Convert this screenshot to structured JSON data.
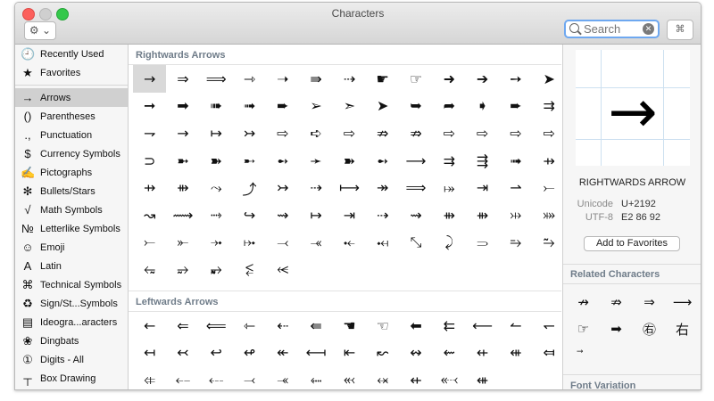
{
  "window": {
    "title": "Characters"
  },
  "toolbar": {
    "gear_label": "⚙ ⌄",
    "search_placeholder": "Search",
    "grid_icon": "⌘"
  },
  "sidebar": {
    "top": [
      {
        "icon": "🕘",
        "label": "Recently Used"
      },
      {
        "icon": "★",
        "label": "Favorites"
      }
    ],
    "items": [
      {
        "icon": "→",
        "label": "Arrows",
        "selected": true
      },
      {
        "icon": "()",
        "label": "Parentheses"
      },
      {
        "icon": ".,",
        "label": "Punctuation"
      },
      {
        "icon": "$",
        "label": "Currency Symbols"
      },
      {
        "icon": "✍",
        "label": "Pictographs"
      },
      {
        "icon": "✻",
        "label": "Bullets/Stars"
      },
      {
        "icon": "√",
        "label": "Math Symbols"
      },
      {
        "icon": "№",
        "label": "Letterlike Symbols"
      },
      {
        "icon": "☺",
        "label": "Emoji"
      },
      {
        "icon": "A",
        "label": "Latin"
      },
      {
        "icon": "⌘",
        "label": "Technical Symbols"
      },
      {
        "icon": "♻",
        "label": "Sign/St...Symbols"
      },
      {
        "icon": "▤",
        "label": "Ideogra...aracters"
      },
      {
        "icon": "❀",
        "label": "Dingbats"
      },
      {
        "icon": "①",
        "label": "Digits - All"
      },
      {
        "icon": "┬",
        "label": "Box Drawing"
      }
    ]
  },
  "sections": [
    {
      "title": "Rightwards Arrows",
      "chars": [
        "→",
        "⇒",
        "⟹",
        "⇾",
        "➝",
        "⇛",
        "⇢",
        "☛",
        "☞",
        "➜",
        "➔",
        "➙",
        "➤",
        "➞",
        "➡",
        "➠",
        "➟",
        "➨",
        "➢",
        "➣",
        "➤",
        "➥",
        "➦",
        "➧",
        "➨",
        "⇉",
        "⇁",
        "→",
        "↦",
        "↣",
        "⇨",
        "➪",
        "⇨",
        "⇏",
        "⇏",
        "⇨",
        "⇨",
        "⇨",
        "⇨",
        "⊃",
        "➼",
        "➽",
        "➸",
        "➻",
        "➛",
        "➽",
        "➻",
        "⟶",
        "⇉",
        "⇶",
        "➟",
        "⇸",
        "⇸",
        "⇻",
        "⤳",
        "⤴",
        "↣",
        "⇢",
        "⟼",
        "↠",
        "⟹",
        "⤅",
        "⇥",
        "⇀",
        "⤚",
        "↝",
        "⟿",
        "⤑",
        "↪",
        "⇝",
        "↦",
        "⇥",
        "⇢",
        "⇝",
        "⇻",
        "⇻",
        "⤔",
        "⤗",
        "⤚",
        "⤜",
        "⤞",
        "⤠",
        "⤙",
        "⤛",
        "⤝",
        "⤟",
        "⤡",
        "⤸",
        "⥰",
        "⥱",
        "⥲",
        "⥳",
        "⥴",
        "⥵",
        "⥶",
        "⥷"
      ],
      "rows": 8
    },
    {
      "title": "Leftwards Arrows",
      "chars": [
        "←",
        "⇐",
        "⟸",
        "⇽",
        "⇠",
        "⇚",
        "☚",
        "☜",
        "⬅",
        "⇇",
        "⟵",
        "↼",
        "↽",
        "↤",
        "↢",
        "↩",
        "↫",
        "↞",
        "⟻",
        "⇤",
        "↜",
        "↭",
        "⇜",
        "⇷",
        "⇺",
        "⤆",
        "⤂",
        "⤌",
        "⤎",
        "⤙",
        "⤛",
        "⬸",
        "⬻",
        "⬾",
        "⇷",
        "⬷",
        "⇺"
      ],
      "rows": 3
    }
  ],
  "detail": {
    "glyph": "→",
    "name": "RIGHTWARDS ARROW",
    "unicode_key": "Unicode",
    "unicode_val": "U+2192",
    "utf8_key": "UTF-8",
    "utf8_val": "E2 86 92",
    "fav_button": "Add to Favorites",
    "related_title": "Related Characters",
    "related": [
      "↛",
      "⇏",
      "⇒",
      "⟶",
      "☞",
      "➡",
      "㊨",
      "右",
      "⃗"
    ],
    "variation_title": "Font Variation"
  }
}
